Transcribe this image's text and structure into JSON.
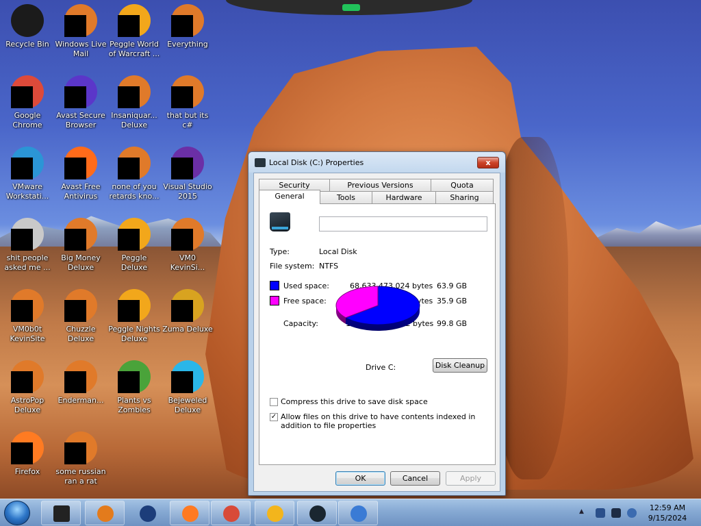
{
  "desktop": {
    "icons": [
      {
        "label": "Recycle Bin",
        "icon": "recycle-bin-icon"
      },
      {
        "label": "Windows Live Mail",
        "icon": "mail-icon"
      },
      {
        "label": "Peggle World of Warcraft ...",
        "icon": "peggle-icon"
      },
      {
        "label": "Everything",
        "icon": "search-app-icon"
      },
      {
        "label": "Google Chrome",
        "icon": "chrome-icon"
      },
      {
        "label": "Avast Secure Browser",
        "icon": "avast-browser-icon"
      },
      {
        "label": "Insaniquar... Deluxe",
        "icon": "fish-game-icon"
      },
      {
        "label": "that but its c#",
        "icon": "shortcut-icon"
      },
      {
        "label": "VMware Workstati...",
        "icon": "vmware-icon"
      },
      {
        "label": "Avast Free Antivirus",
        "icon": "avast-icon"
      },
      {
        "label": "none of you retards kno...",
        "icon": "red-app-icon"
      },
      {
        "label": "Visual Studio 2015",
        "icon": "visual-studio-icon"
      },
      {
        "label": "shit people asked me ...",
        "icon": "document-icon"
      },
      {
        "label": "Big Money Deluxe",
        "icon": "game-icon"
      },
      {
        "label": "Peggle Deluxe",
        "icon": "peggle-icon"
      },
      {
        "label": "VM0 KevinSi...",
        "icon": "vm-icon"
      },
      {
        "label": "VM0b0t KevinSite",
        "icon": "vm-icon"
      },
      {
        "label": "Chuzzle Deluxe",
        "icon": "game-icon"
      },
      {
        "label": "Peggle Nights Deluxe",
        "icon": "peggle-icon"
      },
      {
        "label": "Zuma Deluxe",
        "icon": "zuma-icon"
      },
      {
        "label": "AstroPop Deluxe",
        "icon": "game-icon"
      },
      {
        "label": "Enderman...",
        "icon": "app-icon"
      },
      {
        "label": "Plants vs Zombies",
        "icon": "pvz-icon"
      },
      {
        "label": "Bejeweled Deluxe",
        "icon": "gem-icon"
      },
      {
        "label": "Firefox",
        "icon": "firefox-icon"
      },
      {
        "label": "some russian ran a rat",
        "icon": "app-icon"
      }
    ]
  },
  "window": {
    "title": "Local Disk (C:) Properties",
    "close_label": "x",
    "tabs_row1": [
      "Security",
      "Previous Versions",
      "Quota"
    ],
    "tabs_row2": [
      "General",
      "Tools",
      "Hardware",
      "Sharing"
    ],
    "active_tab": "General",
    "volume_label_value": "",
    "type_label": "Type:",
    "type_value": "Local Disk",
    "fs_label": "File system:",
    "fs_value": "NTFS",
    "used_label": "Used space:",
    "used_bytes": "68,633,473,024 bytes",
    "used_gb": "63.9 GB",
    "free_label": "Free space:",
    "free_bytes": "38,633,750,528 bytes",
    "free_gb": "35.9 GB",
    "capacity_label": "Capacity:",
    "capacity_bytes": "107,267,223,552 bytes",
    "capacity_gb": "99.8 GB",
    "drive_label": "Drive C:",
    "disk_cleanup_label": "Disk Cleanup",
    "compress_label": "Compress this drive to save disk space",
    "compress_checked": false,
    "index_label": "Allow files on this drive to have contents indexed in addition to file properties",
    "index_checked": true,
    "ok_label": "OK",
    "cancel_label": "Cancel",
    "apply_label": "Apply",
    "colors": {
      "used": "#0000ff",
      "free": "#ff00ff"
    },
    "used_fraction": 0.64
  },
  "taskbar": {
    "apps": [
      "drive-properties-icon",
      "media-player-icon",
      "globe-icon",
      "firefox-icon",
      "chrome-icon",
      "avast-browser-icon",
      "monitor-icon",
      "network-app-icon"
    ],
    "clock_time": "12:59 AM",
    "clock_date": "9/15/2024"
  }
}
